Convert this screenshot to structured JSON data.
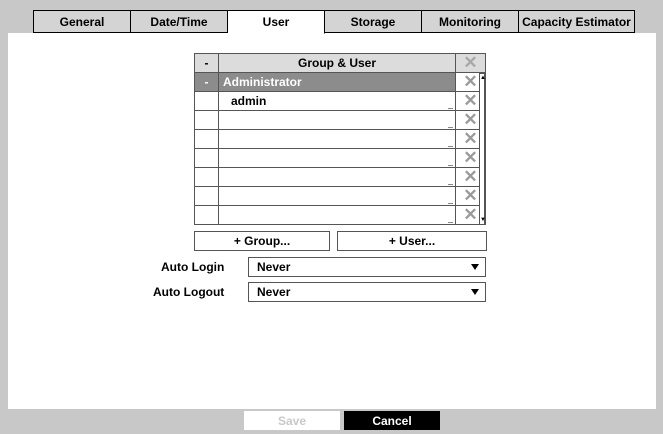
{
  "tabs": [
    "General",
    "Date/Time",
    "User",
    "Storage",
    "Monitoring",
    "Capacity Estimator"
  ],
  "table": {
    "header_minus": "-",
    "header_title": "Group & User",
    "group_minus": "-",
    "group_name": "Administrator",
    "user_name": "admin"
  },
  "buttons": {
    "add_group": "+ Group...",
    "add_user": "+ User...",
    "save": "Save",
    "cancel": "Cancel"
  },
  "auto_login": {
    "label": "Auto Login",
    "value": "Never"
  },
  "auto_logout": {
    "label": "Auto Logout",
    "value": "Never"
  },
  "icons": {
    "delete": "close-icon"
  }
}
